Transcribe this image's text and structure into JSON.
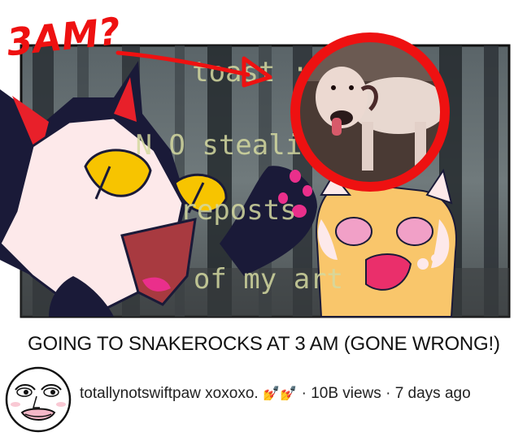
{
  "video": {
    "title": "GOING TO SNAKEROCKS AT 3 AM (GONE WRONG!)",
    "channel": "totallynotswiftpaw xoxoxo.",
    "channel_emoji": "💅💅",
    "separator": "·",
    "views": "10B views",
    "age": "7 days ago"
  },
  "thumbnail": {
    "scrawl_text": "3AM?",
    "watermark": [
      "toast :3",
      "N O stealing or",
      "reposts",
      "of my art"
    ],
    "colors": {
      "annotation_red": "#ee1111",
      "forest_dark": "#2a3035",
      "cat_dark": "#1a1a38",
      "cat_pale": "#fde9ea",
      "eye_yellow": "#f7c400",
      "orange_cat": "#f9c66b",
      "dog_fur": "#e8d8d0"
    }
  },
  "icons": {
    "avatar": "trollface-avatar",
    "arrow": "red-arrow-icon",
    "circle": "red-circle-highlight"
  }
}
